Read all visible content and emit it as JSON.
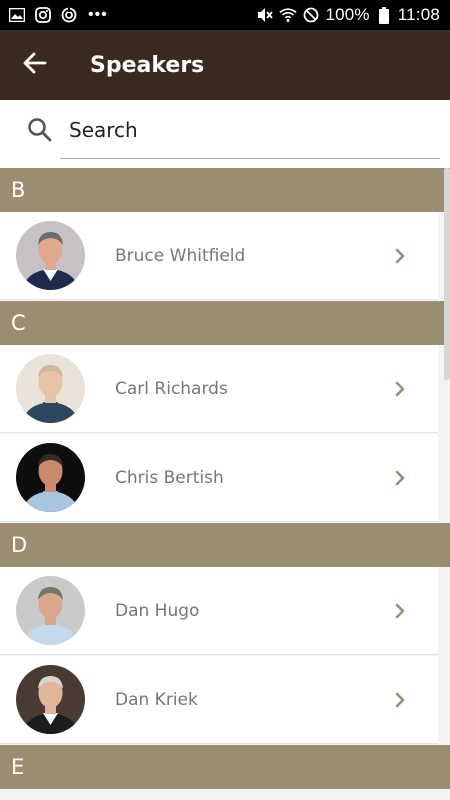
{
  "status_bar": {
    "time": "11:08",
    "battery": "100%",
    "left_icons": [
      "image-icon",
      "instagram-icon",
      "sync-icon",
      "more-dots-icon"
    ],
    "dots": "•••",
    "right_icons": [
      "mute-icon",
      "wifi-icon",
      "do-not-disturb-icon",
      "battery-icon"
    ]
  },
  "app_bar": {
    "title": "Speakers",
    "back_icon": "back-arrow-icon"
  },
  "search": {
    "placeholder": "Search",
    "icon": "search-icon"
  },
  "sections": [
    {
      "letter": "B",
      "speakers": [
        {
          "name": "Bruce Whitfield",
          "avatar_bg": "#c7c0c4",
          "skin": "#e0a98e",
          "hair": "#6b6b6b",
          "shirt": "#ffffff",
          "jacket": "#1e2b4a"
        }
      ]
    },
    {
      "letter": "C",
      "speakers": [
        {
          "name": "Carl Richards",
          "avatar_bg": "#e9e3d8",
          "skin": "#e8c3a8",
          "hair": "#cdb8a0",
          "shirt": "#2e4660",
          "jacket": "#2e4660"
        },
        {
          "name": "Chris Bertish",
          "avatar_bg": "#0d0d0d",
          "skin": "#c98b6c",
          "hair": "#3a2a22",
          "shirt": "#a8c6e0",
          "jacket": "#a8c6e0"
        }
      ]
    },
    {
      "letter": "D",
      "speakers": [
        {
          "name": "Dan Hugo",
          "avatar_bg": "#c9cbc8",
          "skin": "#d9a68e",
          "hair": "#7a7468",
          "shirt": "#c6d8ec",
          "jacket": "#c6d8ec"
        },
        {
          "name": "Dan Kriek",
          "avatar_bg": "#4a3b32",
          "skin": "#e2b49a",
          "hair": "#d8d4cc",
          "shirt": "#ffffff",
          "jacket": "#1c1c1e"
        }
      ]
    },
    {
      "letter": "E",
      "speakers": []
    }
  ],
  "colors": {
    "app_bar": "#3b2a1e",
    "section_header": "#9b8d70",
    "chevron": "#9b8d70",
    "name_text": "#777777"
  }
}
